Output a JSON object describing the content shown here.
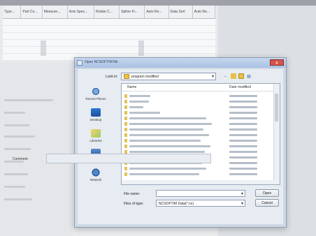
{
  "background_app": {
    "columns": [
      "Type...",
      "Part Co...",
      "Measure...",
      "Axis Spec...",
      "Rotate C...",
      "Spline Fi...",
      "Auto Re...",
      "Data Sort",
      "Auto Re..."
    ]
  },
  "dialog": {
    "title": "Open NCSOFTIM file",
    "look_in_label": "Look in:",
    "look_in_value": "program modified",
    "places": [
      "Recent Places",
      "Desktop",
      "Libraries",
      "Computer",
      "Network"
    ],
    "columns": {
      "name": "Name",
      "date": "Date modified"
    },
    "file_name_label": "File name:",
    "file_name_value": "",
    "file_type_label": "Files of type:",
    "file_type_value": "NCSOFTIM Data(*.nc)",
    "open_label": "Open",
    "cancel_label": "Cancel",
    "close_glyph": "x"
  },
  "comment_label": "Comment"
}
